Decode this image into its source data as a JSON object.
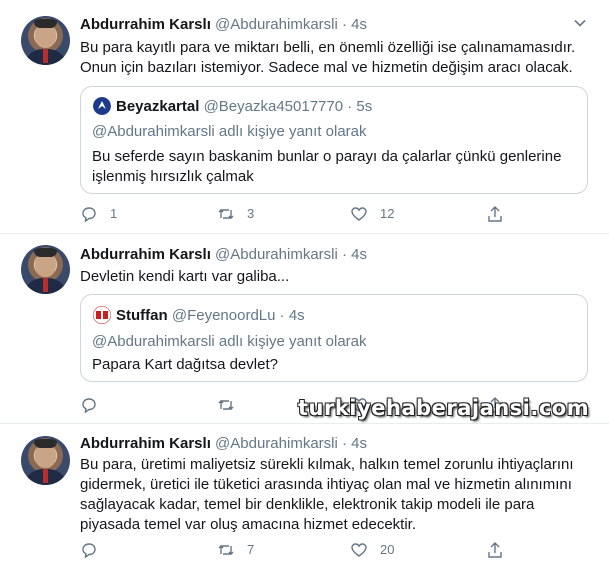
{
  "colors": {
    "accent": "#1da1f2",
    "muted": "#657786",
    "text": "#14171a",
    "border": "#ccd6dd"
  },
  "tweets": [
    {
      "name": "Abdurrahim Karslı",
      "handle": "@Abdurahimkarsli",
      "dot": "·",
      "time": "4s",
      "text": "Bu para kayıtlı para ve miktarı belli, en önemli özelliği ise çalınamamasıdır. Onun için bazıları istemiyor. Sadece mal ve hizmetin değişim aracı olacak.",
      "quote": {
        "name": "Beyazkartal",
        "handle": "@Beyazka45017770",
        "dot": "·",
        "time": "5s",
        "replying": "@Abdurahimkarsli adlı kişiye yanıt olarak",
        "text": "Bu seferde sayın baskanim bunlar o parayı da çalarlar çünkü genlerine işlenmiş hırsızlık çalmak"
      },
      "actions": {
        "reply": "1",
        "retweet": "3",
        "like": "12"
      }
    },
    {
      "name": "Abdurrahim Karslı",
      "handle": "@Abdurahimkarsli",
      "dot": "·",
      "time": "4s",
      "text": "Devletin kendi kartı var galiba...",
      "quote": {
        "name": "Stuffan",
        "handle": "@FeyenoordLu",
        "dot": "·",
        "time": "4s",
        "replying": "@Abdurahimkarsli adlı kişiye yanıt olarak",
        "text": "Papara Kart dağıtsa devlet?"
      },
      "actions": {
        "reply": "",
        "retweet": "",
        "like": ""
      }
    },
    {
      "name": "Abdurrahim Karslı",
      "handle": "@Abdurahimkarsli",
      "dot": "·",
      "time": "4s",
      "text": "Bu para, üretimi maliyetsiz sürekli kılmak, halkın temel zorunlu ihtiyaçlarını gidermek, üretici ile tüketici arasında ihtiyaç olan mal ve hizmetin alınımını sağlayacak kadar, temel bir denklikle, elektronik takip modeli ile para piyasada temel var oluş amacına hizmet edecektir.",
      "actions": {
        "reply": "",
        "retweet": "7",
        "like": "20"
      }
    }
  ],
  "watermark": "turkiyehaberajansi.com"
}
